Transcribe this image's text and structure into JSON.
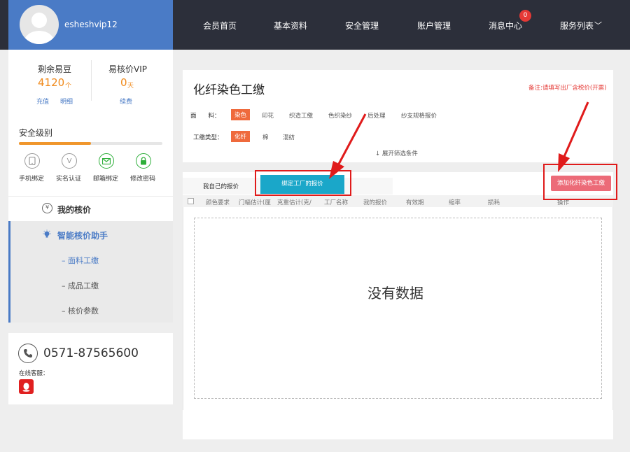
{
  "header": {
    "username": "esheshvip12",
    "nav": [
      "会员首页",
      "基本资料",
      "安全管理",
      "账户管理",
      "消息中心",
      "服务列表"
    ],
    "message_count": "0"
  },
  "account": {
    "beans_label": "剩余易豆",
    "beans_value": "4120",
    "beans_unit": "个",
    "recharge": "充值",
    "detail": "明细",
    "vip_label": "易核价VIP",
    "vip_value": "0",
    "vip_unit": "天",
    "renew": "续费"
  },
  "security": {
    "title": "安全级别",
    "level_fraction": 0.5,
    "items": [
      "手机绑定",
      "实名认证",
      "邮箱绑定",
      "修改密码"
    ]
  },
  "menu": {
    "my_quotes": "我的核价",
    "assistant": "智能核价助手",
    "subs": [
      "面料工缴",
      "成品工缴",
      "核价参数"
    ]
  },
  "contact": {
    "phone": "0571-87565600",
    "online_label": "在线客服："
  },
  "main": {
    "title": "化纤染色工缴",
    "note": "备注:请填写出厂含税价(开票)",
    "fabric_label": "面　　料：",
    "fabric_options": [
      "染色",
      "印花",
      "织造工缴",
      "色织染纱",
      "后处理",
      "纱支规格报价"
    ],
    "type_label": "工缴类型：",
    "type_options": [
      "化纤",
      "棉",
      "混纺"
    ],
    "expand": "展开筛选条件",
    "tabs": [
      "我自己的报价",
      "绑定工厂的报价"
    ],
    "add_button": "添加化纤染色工缴",
    "columns": [
      "颜色要求",
      "门幅估计(厘",
      "克重估计(克/",
      "工厂名称",
      "我的报价",
      "有效期",
      "缩率",
      "损耗",
      "操作"
    ],
    "empty": "没有数据"
  },
  "colors": {
    "brand_blue": "#4a7bc6",
    "nav_dark": "#2c2f3a",
    "accent_orange": "#ef6a3c",
    "tab_active": "#1aa7c9",
    "add_button": "#ec6b78",
    "highlight_red": "#e01b1b"
  }
}
